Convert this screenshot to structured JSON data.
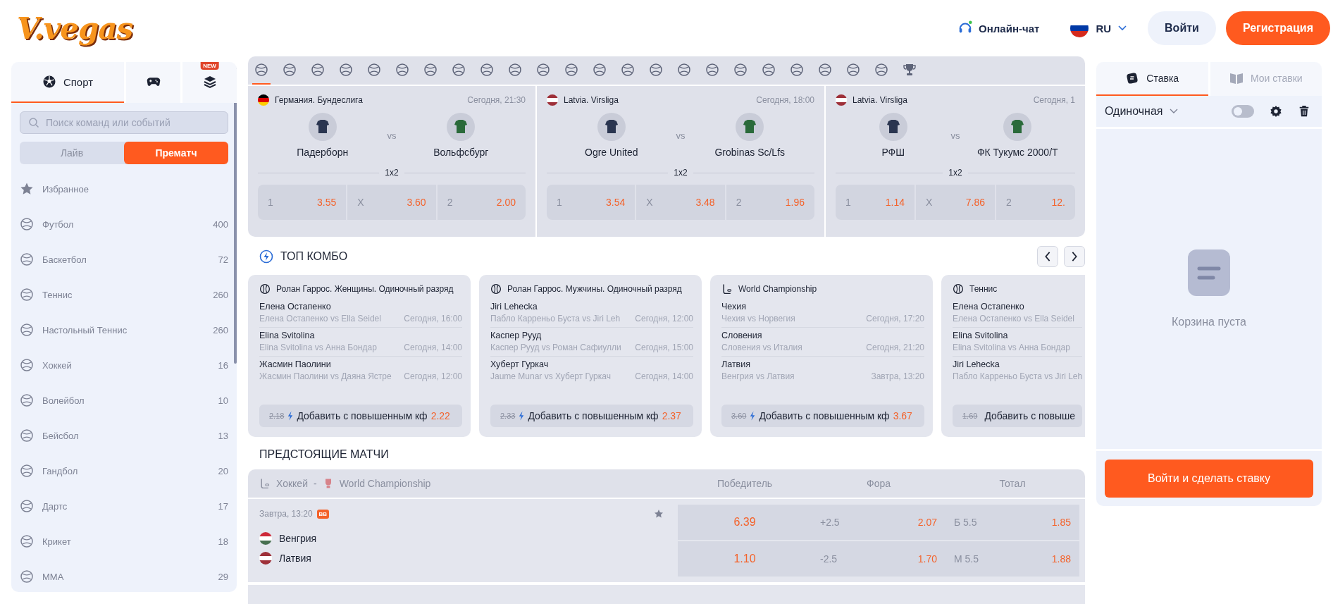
{
  "header": {
    "logo": "V.vegas",
    "chat": "Онлайн-чат",
    "language": {
      "kind": "ru",
      "code": "RU"
    },
    "login": "Войти",
    "register": "Регистрация"
  },
  "sidebar": {
    "tabs": [
      {
        "kind": "sport",
        "label": "Спорт",
        "selected": true
      },
      {
        "kind": "games",
        "selected": false
      },
      {
        "kind": "layers",
        "badge": "NEW",
        "selected": false
      }
    ],
    "search": {
      "placeholder": "Поиск команд или событий"
    },
    "modes": [
      {
        "label": "Лайв",
        "selected": false
      },
      {
        "label": "Прематч",
        "selected": true
      }
    ],
    "items": [
      {
        "kind": "favorites",
        "label": "Избранное"
      },
      {
        "kind": "sport",
        "label": "Футбол",
        "count": "400"
      },
      {
        "kind": "sport",
        "label": "Баскетбол",
        "count": "72"
      },
      {
        "kind": "sport",
        "label": "Теннис",
        "count": "260"
      },
      {
        "kind": "sport",
        "label": "Настольный Теннис",
        "count": "260"
      },
      {
        "kind": "sport",
        "label": "Хоккей",
        "count": "16"
      },
      {
        "kind": "sport",
        "label": "Волейбол",
        "count": "10"
      },
      {
        "kind": "sport",
        "label": "Бейсбол",
        "count": "13"
      },
      {
        "kind": "sport",
        "label": "Гандбол",
        "count": "20"
      },
      {
        "kind": "sport",
        "label": "Дартс",
        "count": "17"
      },
      {
        "kind": "sport",
        "label": "Крикет",
        "count": "18"
      },
      {
        "kind": "sport",
        "label": "MMA",
        "count": "29"
      }
    ]
  },
  "sport_tabs": [
    {
      "kind": "ball",
      "selected": true
    },
    {
      "kind": "ball",
      "selected": false
    },
    {
      "kind": "ball",
      "selected": false
    },
    {
      "kind": "ball",
      "selected": false
    },
    {
      "kind": "ball",
      "selected": false
    },
    {
      "kind": "ball",
      "selected": false
    },
    {
      "kind": "ball",
      "selected": false
    },
    {
      "kind": "ball",
      "selected": false
    },
    {
      "kind": "ball",
      "selected": false
    },
    {
      "kind": "ball",
      "selected": false
    },
    {
      "kind": "ball",
      "selected": false
    },
    {
      "kind": "ball",
      "selected": false
    },
    {
      "kind": "ball",
      "selected": false
    },
    {
      "kind": "ball",
      "selected": false
    },
    {
      "kind": "ball",
      "selected": false
    },
    {
      "kind": "ball",
      "selected": false
    },
    {
      "kind": "ball",
      "selected": false
    },
    {
      "kind": "ball",
      "selected": false
    },
    {
      "kind": "ball",
      "selected": false
    },
    {
      "kind": "ball",
      "selected": false
    },
    {
      "kind": "ball",
      "selected": false
    },
    {
      "kind": "ball",
      "selected": false
    },
    {
      "kind": "ball",
      "selected": false
    },
    {
      "kind": "trophy",
      "selected": false
    }
  ],
  "matches": [
    {
      "kind": "de",
      "league": "Германия. Бундеслига",
      "time": "Сегодня, 21:30",
      "home": "Падерборн",
      "vs": "vs",
      "away": "Вольфсбург",
      "market": "1x2",
      "odds": [
        {
          "label": "1",
          "value": "3.55"
        },
        {
          "label": "X",
          "value": "3.60"
        },
        {
          "label": "2",
          "value": "2.00"
        }
      ]
    },
    {
      "kind": "lv",
      "league": "Latvia. Virsliga",
      "time": "Сегодня, 18:00",
      "home": "Ogre United",
      "vs": "vs",
      "away": "Grobinas Sc/Lfs",
      "market": "1x2",
      "odds": [
        {
          "label": "1",
          "value": "3.54"
        },
        {
          "label": "X",
          "value": "3.48"
        },
        {
          "label": "2",
          "value": "1.96"
        }
      ]
    },
    {
      "kind": "lv",
      "league": "Latvia. Virsliga",
      "time": "Сегодня, 1",
      "home": "РФШ",
      "vs": "vs",
      "away": "ФК Тукумс 2000/Т",
      "market": "1x2",
      "odds": [
        {
          "label": "1",
          "value": "1.14"
        },
        {
          "label": "X",
          "value": "7.86"
        },
        {
          "label": "2",
          "value": "12."
        }
      ]
    }
  ],
  "top_combo": {
    "title": "ТОП КОМБО",
    "cards": [
      {
        "kind": "tennis",
        "title": "Ролан Гаррос. Женщины. Одиночный разряд",
        "rows": [
          {
            "player": "Елена Остапенко",
            "match": "Елена Остапенко vs Ella Seidel",
            "time": "Сегодня, 16:00"
          },
          {
            "player": "Elina Svitolina",
            "match": "Elina Svitolina vs Анна Бондар",
            "time": "Сегодня, 14:00"
          },
          {
            "player": "Жасмин Паолини",
            "match": "Жасмин Паолини vs Даяна Ястре",
            "time": "Сегодня, 12:00"
          }
        ],
        "old_odds": "2.18",
        "action": "Добавить с повышенным кф",
        "new_odds": "2.22"
      },
      {
        "kind": "tennis",
        "title": "Ролан Гаррос. Мужчины. Одиночный разряд",
        "rows": [
          {
            "player": "Jiri Lehecka",
            "match": "Пабло Карреньо Буста vs Jiri Leh",
            "time": "Сегодня, 12:00"
          },
          {
            "player": "Каспер Рууд",
            "match": "Каспер Рууд vs Роман Сафиулли",
            "time": "Сегодня, 15:00"
          },
          {
            "player": "Хуберт Гуркач",
            "match": "Jaume Munar vs Хуберт Гуркач",
            "time": "Сегодня, 14:00"
          }
        ],
        "old_odds": "2.33",
        "action": "Добавить с повышенным кф",
        "new_odds": "2.37"
      },
      {
        "kind": "hockey",
        "title": "World Championship",
        "rows": [
          {
            "player": "Чехия",
            "match": "Чехия vs Норвегия",
            "time": "Сегодня, 17:20"
          },
          {
            "player": "Словения",
            "match": "Словения vs Италия",
            "time": "Сегодня, 21:20"
          },
          {
            "player": "Латвия",
            "match": "Венгрия vs Латвия",
            "time": "Завтра, 13:20"
          }
        ],
        "old_odds": "3.60",
        "action": "Добавить с повышенным кф",
        "new_odds": "3.67"
      },
      {
        "kind": "tennis",
        "title": "Теннис",
        "rows": [
          {
            "player": "Елена Остапенко",
            "match": "Елена Остапенко vs Ella Seidel"
          },
          {
            "player": "Elina Svitolina",
            "match": "Elina Svitolina vs Анна Бондар"
          },
          {
            "player": "Jiri Lehecka",
            "match": "Пабло Карреньо Буста vs Jiri Leh"
          }
        ],
        "old_odds": "1.69",
        "action": "Добавить с повыше"
      }
    ]
  },
  "upcoming": {
    "title": "ПРЕДСТОЯЩИЕ МАТЧИ",
    "sport": "Хоккей",
    "separator": "-",
    "league": "World Championship",
    "columns": [
      "Победитель",
      "Фора",
      "Тотал"
    ],
    "events": [
      {
        "time": "Завтра, 13:20",
        "badge": "BB",
        "teams": [
          {
            "kind": "hu",
            "name": "Венгрия"
          },
          {
            "kind": "lv",
            "name": "Латвия"
          }
        ],
        "winner": [
          "6.39",
          "1.10"
        ],
        "handicap": [
          {
            "line": "+2.5",
            "odds": "2.07"
          },
          {
            "line": "-2.5",
            "odds": "1.70"
          }
        ],
        "total": [
          {
            "line": "Б 5.5",
            "odds": "1.85"
          },
          {
            "line": "М 5.5",
            "odds": "1.88"
          }
        ]
      }
    ]
  },
  "betslip": {
    "tabs": [
      {
        "kind": "bet",
        "label": "Ставка",
        "selected": true
      },
      {
        "kind": "book",
        "label": "Мои ставки",
        "selected": false
      }
    ],
    "type": "Одиночная",
    "toggle": {
      "on": false
    },
    "empty": "Корзина пуста",
    "submit": "Войти и сделать ставку"
  }
}
